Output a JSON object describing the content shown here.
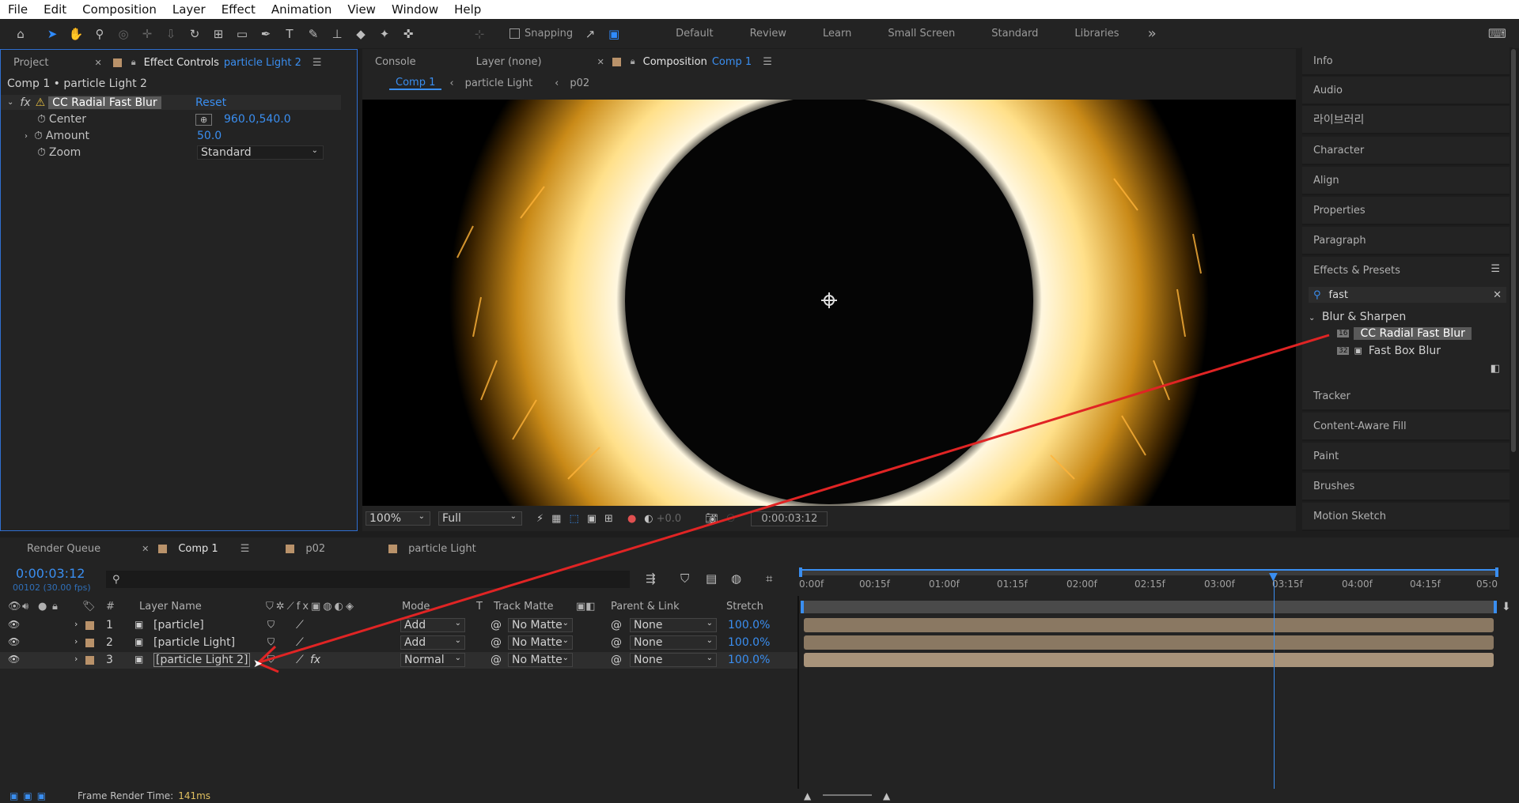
{
  "menu": [
    "File",
    "Edit",
    "Composition",
    "Layer",
    "Effect",
    "Animation",
    "View",
    "Window",
    "Help"
  ],
  "toolbar": {
    "snapping": "Snapping",
    "workspaces": [
      "Default",
      "Review",
      "Learn",
      "Small Screen",
      "Standard",
      "Libraries"
    ],
    "more": "»"
  },
  "left_panel": {
    "tabs": {
      "project": "Project",
      "effect_controls": "Effect Controls",
      "effect_layer": "particle Light 2"
    },
    "comp_path": "Comp 1 • particle Light 2",
    "effect": {
      "fx": "fx",
      "name": "CC Radial Fast Blur",
      "reset": "Reset"
    },
    "props": [
      {
        "label": "Center",
        "value": "960.0,540.0"
      },
      {
        "label": "Amount",
        "value": "50.0"
      },
      {
        "label": "Zoom",
        "value": "Standard"
      }
    ]
  },
  "viewer": {
    "tabs": {
      "console": "Console",
      "layer": "Layer (none)",
      "composition": "Composition",
      "comp_name": "Comp 1"
    },
    "breadcrumbs": [
      "Comp 1",
      "particle Light",
      "p02"
    ],
    "zoom": "100%",
    "resolution": "Full",
    "exposure": "+0.0",
    "timecode": "0:00:03:12"
  },
  "right_panel": {
    "tabs": [
      "Info",
      "Audio",
      "라이브러리",
      "Character",
      "Align",
      "Properties",
      "Paragraph"
    ],
    "effects_presets": "Effects & Presets",
    "search": "fast",
    "category": "Blur & Sharpen",
    "results": [
      {
        "badge": "16",
        "name": "CC Radial Fast Blur"
      },
      {
        "badge": "32",
        "name": "Fast Box Blur"
      }
    ],
    "lower_tabs": [
      "Tracker",
      "Content-Aware Fill",
      "Paint",
      "Brushes",
      "Motion Sketch"
    ]
  },
  "timeline": {
    "tabs": {
      "render_queue": "Render Queue",
      "comp": "Comp 1",
      "p02": "p02",
      "particle_light": "particle Light"
    },
    "timecode": "0:00:03:12",
    "frame_info": "00102 (30.00 fps)",
    "columns": {
      "num": "#",
      "layer_name": "Layer Name",
      "mode": "Mode",
      "t": "T",
      "track_matte": "Track Matte",
      "parent": "Parent & Link",
      "stretch": "Stretch"
    },
    "ruler": [
      "0:00f",
      "00:15f",
      "01:00f",
      "01:15f",
      "02:00f",
      "02:15f",
      "03:00f",
      "03:15f",
      "04:00f",
      "04:15f",
      "05:0"
    ],
    "playhead_fraction": 0.682,
    "layers": [
      {
        "num": "1",
        "name": "[particle]",
        "mode": "Add",
        "matte": "No Matte",
        "parent": "None",
        "stretch": "100.0%"
      },
      {
        "num": "2",
        "name": "[particle Light]",
        "mode": "Add",
        "matte": "No Matte",
        "parent": "None",
        "stretch": "100.0%"
      },
      {
        "num": "3",
        "name": "[particle Light 2]",
        "mode": "Normal",
        "matte": "No Matte",
        "parent": "None",
        "stretch": "100.0%"
      }
    ]
  },
  "status": {
    "label": "Frame Render Time:",
    "value": "141ms"
  },
  "colors": {
    "accent": "#3a8ef0",
    "annotation_arrow": "#e02424",
    "layer_label": "#b9926a",
    "render_time": "#e0c060"
  }
}
